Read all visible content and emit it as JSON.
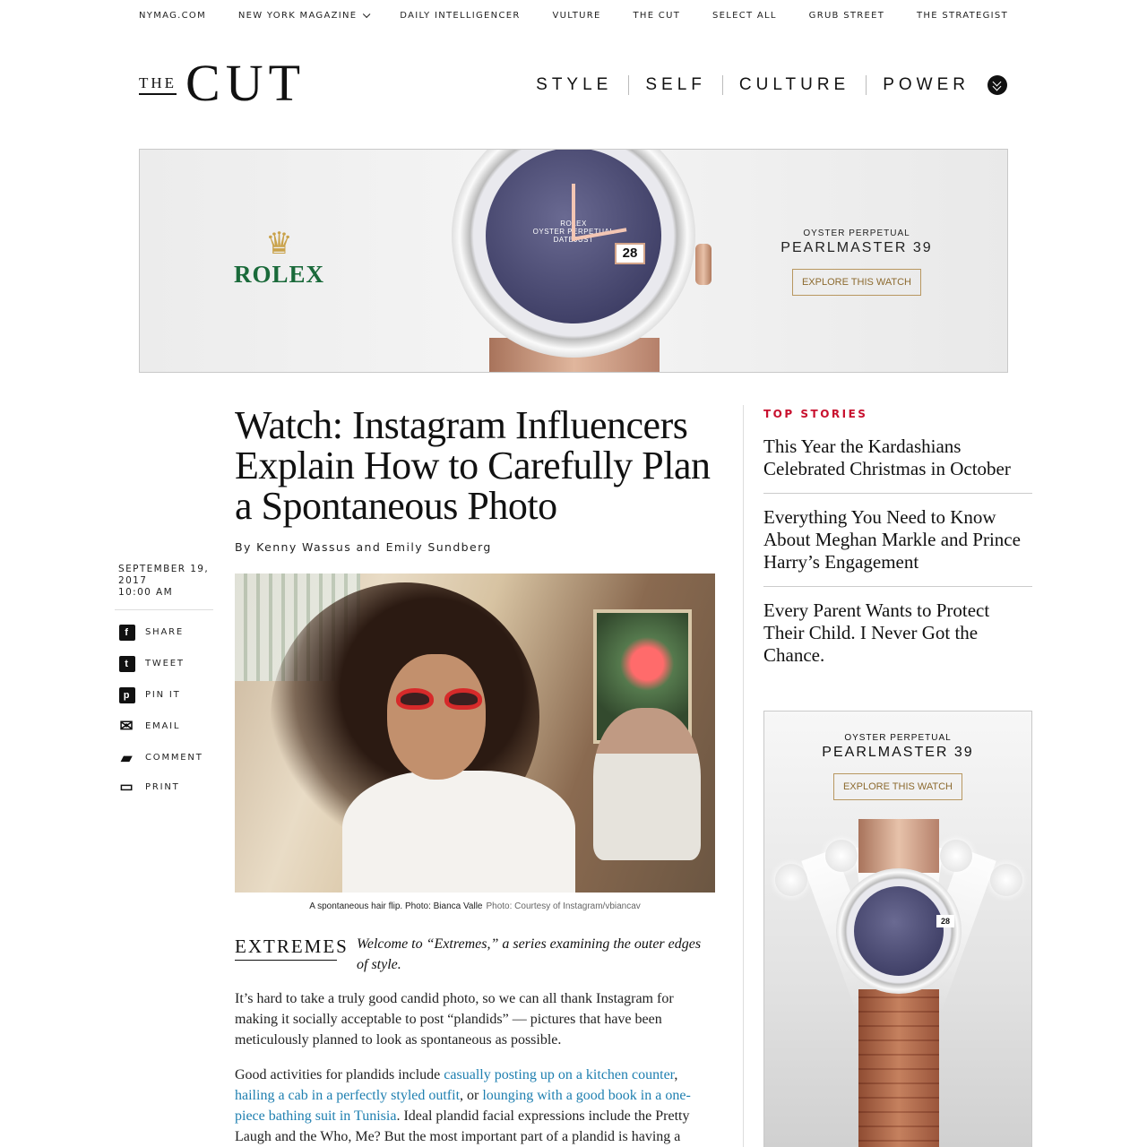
{
  "network_nav": [
    {
      "label": "NYMAG.COM"
    },
    {
      "label": "NEW YORK MAGAZINE",
      "has_dropdown": true
    },
    {
      "label": "DAILY INTELLIGENCER"
    },
    {
      "label": "VULTURE"
    },
    {
      "label": "THE CUT"
    },
    {
      "label": "SELECT ALL"
    },
    {
      "label": "GRUB STREET"
    },
    {
      "label": "THE STRATEGIST"
    }
  ],
  "masthead": {
    "the": "THE",
    "cut": "CUT"
  },
  "section_nav": [
    "STYLE",
    "SELF",
    "CULTURE",
    "POWER"
  ],
  "top_ad": {
    "brand": "ROLEX",
    "line1": "OYSTER PERPETUAL",
    "line2": "PEARLMASTER 39",
    "cta": "EXPLORE THIS WATCH",
    "dial_text": "ROLEX\nOYSTER PERPETUAL\nDATEJUST",
    "date": "28",
    "brand_color": "#1a6a3a",
    "gold_color": "#c9a24a"
  },
  "article": {
    "headline": "Watch: Instagram Influencers Explain How to Carefully Plan a Spontaneous Photo",
    "byline": "By Kenny Wassus and Emily Sundberg",
    "date": "SEPTEMBER 19, 2017",
    "time": "10:00 AM",
    "caption": "A spontaneous hair flip. Photo: Bianca Valle",
    "credit": "Photo: Courtesy of Instagram/vbiancav",
    "series_logo": "EXTREMES",
    "intro": "Welcome to “Extremes,” a series examining the outer edges of style.",
    "p1": "It’s hard to take a truly good candid photo, so we can all thank Instagram for making it socially acceptable to post “plandids” — pictures that have been meticulously planned to look as spontaneous as possible.",
    "p2": {
      "t1": "Good activities for plandids include ",
      "link1": "casually posting up on a kitchen counter",
      "t2": ", ",
      "link2": "hailing a cab in a perfectly styled outfit",
      "t3": ", or ",
      "link3": "lounging with a good book in a one-piece bathing suit in Tunisia",
      "t4": ". Ideal plandid facial expressions include the Pretty Laugh and the Who, Me? But the most important part of a plandid is having a"
    },
    "link_color": "#1e7fb0"
  },
  "share": [
    {
      "icon": "facebook-icon",
      "glyph": "f",
      "label": "SHARE"
    },
    {
      "icon": "twitter-icon",
      "glyph": "t",
      "label": "TWEET"
    },
    {
      "icon": "pinterest-icon",
      "glyph": "p",
      "label": "PIN IT"
    },
    {
      "icon": "email-icon",
      "glyph": "✉",
      "label": "EMAIL"
    },
    {
      "icon": "comment-icon",
      "glyph": "▰",
      "label": "COMMENT"
    },
    {
      "icon": "print-icon",
      "glyph": "▭",
      "label": "PRINT"
    }
  ],
  "top_stories": {
    "label": "TOP STORIES",
    "label_color": "#c8102e",
    "items": [
      "This Year the Kardashians Celebrated Christmas in October",
      "Everything You Need to Know About Meghan Markle and Prince Harry’s Engagement",
      "Every Parent Wants to Protect Their Child. I Never Got the Chance."
    ]
  },
  "side_ad": {
    "line1": "OYSTER PERPETUAL",
    "line2": "PEARLMASTER 39",
    "cta": "EXPLORE THIS WATCH",
    "date": "28"
  }
}
